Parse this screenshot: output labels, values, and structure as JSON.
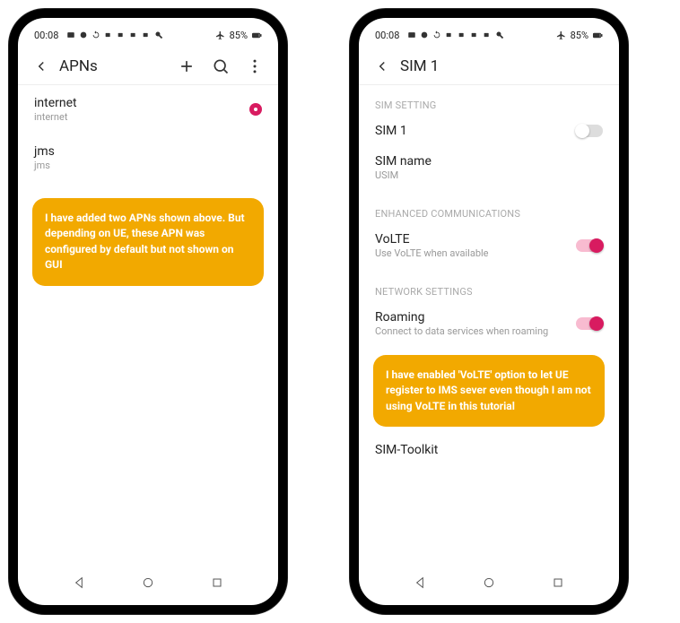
{
  "status_bar": {
    "time": "00:08",
    "battery_text": "85%"
  },
  "left_phone": {
    "header": {
      "title": "APNs"
    },
    "apns": [
      {
        "title": "internet",
        "sub": "internet",
        "selected": true
      },
      {
        "title": "jms",
        "sub": "jms",
        "selected": false
      }
    ],
    "note": "I have added two APNs shown above. But depending on UE, these APN was configured by default but not shown on GUI"
  },
  "right_phone": {
    "header": {
      "title": "SIM 1"
    },
    "sections": {
      "sim_setting": {
        "header": "SIM SETTING",
        "sim_row": {
          "title": "SIM 1",
          "on": false
        },
        "sim_name": {
          "title": "SIM name",
          "sub": "USIM"
        }
      },
      "enhanced": {
        "header": "ENHANCED COMMUNICATIONS",
        "volte": {
          "title": "VoLTE",
          "sub": "Use VoLTE when available",
          "on": true
        }
      },
      "network": {
        "header": "NETWORK SETTINGS",
        "roaming": {
          "title": "Roaming",
          "sub": "Connect to data services when roaming",
          "on": true
        }
      },
      "sim_toolkit": {
        "title": "SIM-Toolkit"
      }
    },
    "note": "I have enabled 'VoLTE' option to let UE register to IMS sever even though I am not using VoLTE in this tutorial"
  }
}
